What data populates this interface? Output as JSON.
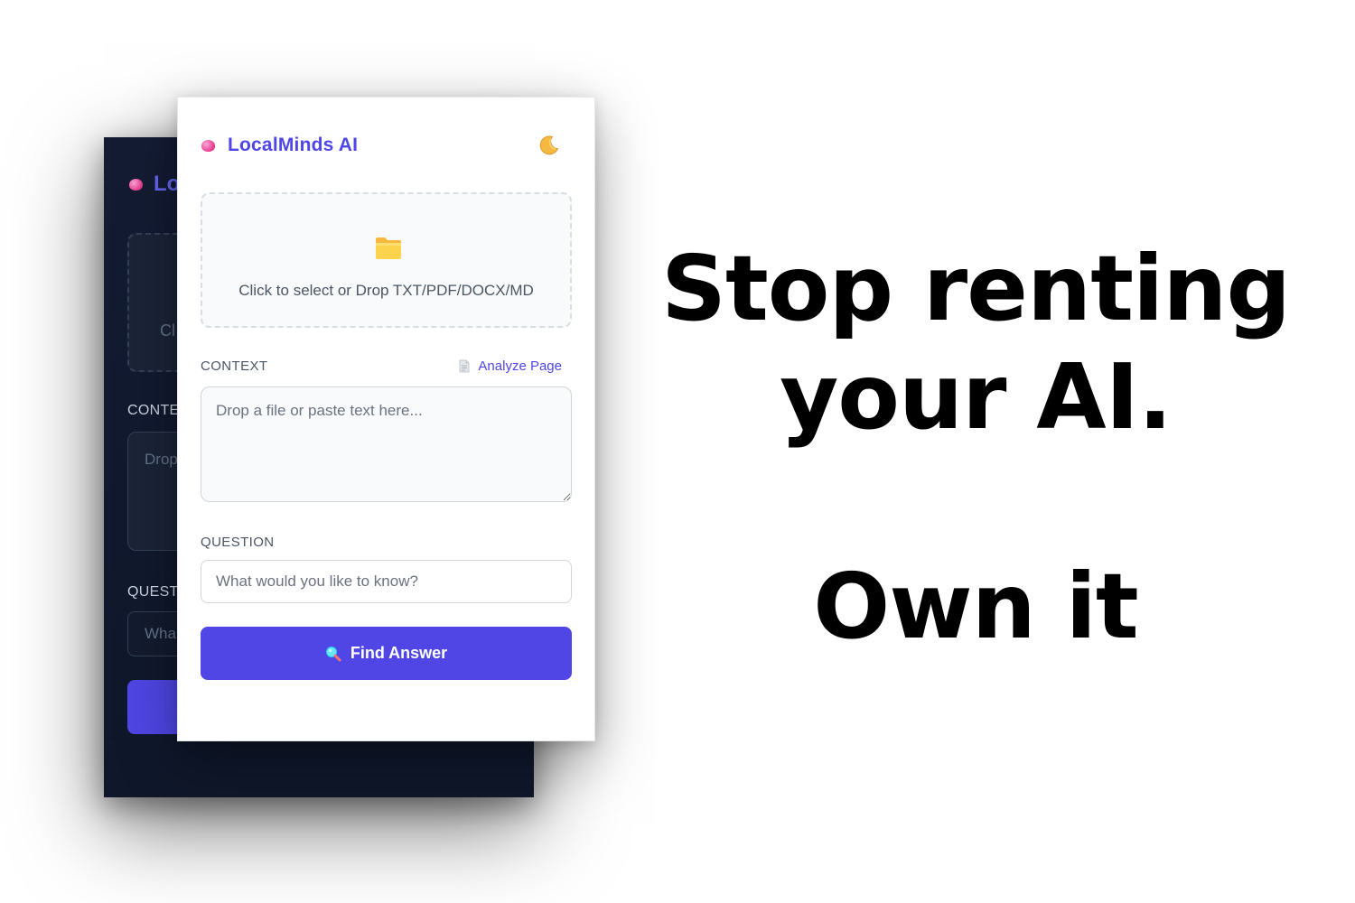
{
  "app": {
    "title": "LocalMinds AI",
    "theme_toggle_icon": "moon-icon",
    "brand_icon": "brain-icon",
    "accent_color": "#4f46e5"
  },
  "dark_preview": {
    "brand_title_partial": "Lo",
    "dropzone_text_partial": "Cl",
    "context_label_partial": "CONTE",
    "textarea_placeholder_partial": "Drop",
    "question_label_partial": "QUEST",
    "input_placeholder_partial": "Wha",
    "background_color": "#0f172a"
  },
  "upload": {
    "icon": "folder-icon",
    "text": "Click to select or Drop TXT/PDF/DOCX/MD"
  },
  "context": {
    "label": "CONTEXT",
    "analyze_label": "Analyze Page",
    "analyze_icon": "document-icon",
    "placeholder": "Drop a file or paste text here..."
  },
  "question": {
    "label": "QUESTION",
    "placeholder": "What would you like to know?"
  },
  "action": {
    "label": "Find Answer",
    "icon": "magnifier-icon"
  },
  "headline": {
    "line1": "Stop renting",
    "line2": "your AI.",
    "line3": "Own it"
  }
}
